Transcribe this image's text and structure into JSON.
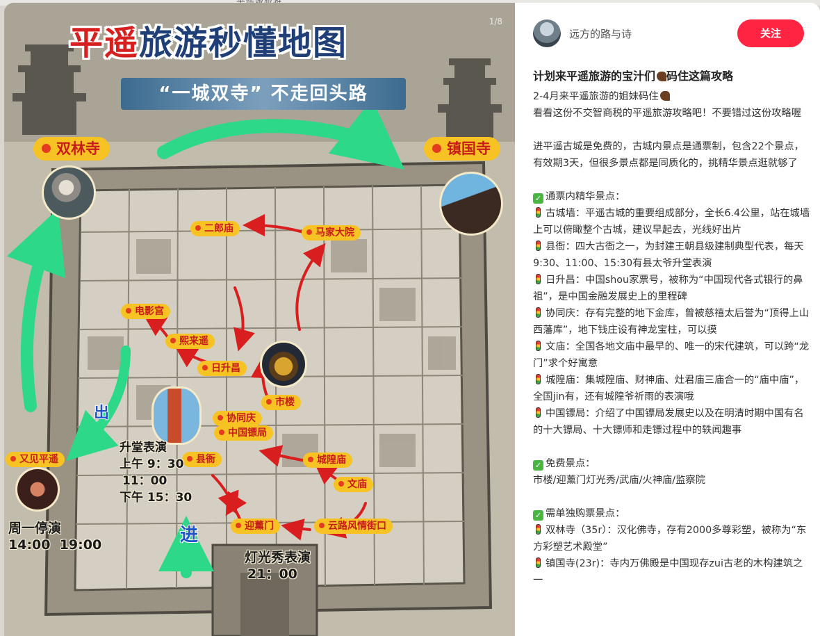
{
  "window": {
    "top_tab_text": "平遥城旅游"
  },
  "image": {
    "page_indicator": "1/8",
    "title_red": "平遥",
    "title_rest": "旅游秒懂地图",
    "subtitle": "“一城双寺”  不走回头路",
    "temples": {
      "left": "双林寺",
      "right": "镇国寺"
    },
    "spots": {
      "erlang": "二郎庙",
      "majia": "马家大院",
      "dianying": "电影宫",
      "xilai": "熙来遥",
      "rishengchang": "日升昌",
      "shilou": "市楼",
      "xietongqing": "协同庆",
      "biaoju": "中国镖局",
      "xianya": "县衙",
      "chenghuang": "城隍庙",
      "wenmiao": "文庙",
      "yingxun": "迎薰门",
      "yunlu": "云路风情街口",
      "youjian": "又见平遥"
    },
    "exit_label": "出",
    "enter_label": "进",
    "court_show": {
      "title": "升堂表演",
      "line1": "上午 9：30",
      "line2": "11：00",
      "line3": "下午 15：30"
    },
    "weekly": {
      "title": "周一停演",
      "times": "14:00  19:00"
    },
    "light_show": {
      "title": "灯光秀表演",
      "time": "21：00"
    }
  },
  "post": {
    "author": "远方的路与诗",
    "follow_label": "关注",
    "title": "计划来平遥旅游的宝汁们",
    "title_tail": "码住这篇攻略",
    "paragraphs": [
      "2-4月来平遥旅游的姐妹码住",
      "看看这份不交智商税的平遥旅游攻略吧！不要错过这份攻略喔",
      "",
      "进平遥古城是免费的，古城内景点是通票制，包含22个景点，有效期3天，但很多景点都是同质化的，挑精华景点逛就够了",
      "",
      "通票内精华景点：",
      "古城墙：平遥古城的重要组成部分，全长6.4公里，站在城墙上可以俯瞰整个古城，建议早起去，光线好出片",
      "县衙：四大古衙之一，为封建王朝县级建制典型代表，每天9:30、11:00、15:30有县太爷升堂表演",
      "日升昌：中国shou家票号，被称为“中国现代各式银行的鼻祖”，是中国金融发展史上的里程碑",
      "协同庆：存有完整的地下金库，曾被慈禧太后誉为“顶得上山西藩库”，地下钱庄设有神龙宝柱，可以摸",
      "文庙：全国各地文庙中最早的、唯一的宋代建筑，可以跨“龙门”求个好寓意",
      "城隍庙：集城隍庙、财神庙、灶君庙三庙合一的“庙中庙”，全国jin有，还有城隍爷祈雨的表演哦",
      "中国镖局：介绍了中国镖局发展史以及在明清时期中国有名的十大镖局、十大镖师和走镖过程中的轶闻趣事",
      "",
      "免费景点：",
      "市楼/迎薰门灯光秀/武庙/火神庙/监察院",
      "",
      "需单独购票景点：",
      "双林寺（35r）：汉化佛寺，存有2000多尊彩塑，被称为“东方彩塑艺术殿堂”",
      "镇国寺(23r)：寺内万佛殿是中国现存zui古老的木构建筑之一"
    ]
  },
  "colors": {
    "accent": "#ff2442",
    "pill": "#f7c324",
    "pill_text": "#c61c1c",
    "arrow_green": "#2ed889",
    "arrow_red": "#d81e1e"
  }
}
